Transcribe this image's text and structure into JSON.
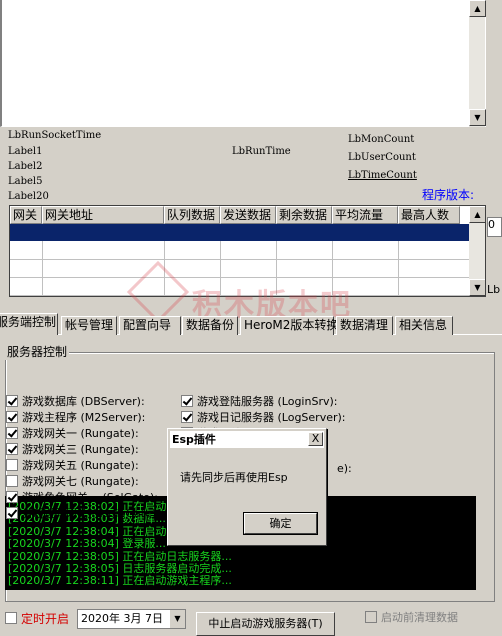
{
  "labels": {
    "lb_run_socket_time": "LbRunSocketTime",
    "label1": "Label1",
    "label2": "Label2",
    "label5": "Label5",
    "label20": "Label20",
    "lb_run_time": "LbRunTime",
    "lb_mon_count": "LbMonCount",
    "lb_user_count": "LbUserCount",
    "lb_time_count": "LbTimeCount",
    "program_version": "程序版本:"
  },
  "grid": {
    "columns": [
      "网关",
      "网关地址",
      "队列数据",
      "发送数据",
      "剩余数据",
      "平均流量",
      "最高人数"
    ]
  },
  "side": {
    "input_text": "0",
    "lb_text": "Lb"
  },
  "tabs": [
    "服务端控制",
    "帐号管理",
    "配置向导",
    "数据备份",
    "HeroM2版本转换",
    "数据清理",
    "相关信息"
  ],
  "server_control": {
    "title": "服务器控制",
    "left": [
      {
        "label": "游戏数据库 (DBServer):",
        "checked": true
      },
      {
        "label": "游戏主程序 (M2Server):",
        "checked": true
      },
      {
        "label": "游戏网关一 (Rungate):",
        "checked": true
      },
      {
        "label": "游戏网关三 (Rungate):",
        "checked": true
      },
      {
        "label": "游戏网关五 (Rungate):",
        "checked": false
      },
      {
        "label": "游戏网关七 (Rungate):",
        "checked": false
      },
      {
        "label": "游戏角色网关一 (SelGate):",
        "checked": true
      },
      {
        "label": "游戏登陆网关 (LoginGate):",
        "checked": true
      }
    ],
    "right": [
      {
        "label": "游戏登陆服务器 (LoginSrv):",
        "checked": true
      },
      {
        "label": "游戏日记服务器 (LogServer):",
        "checked": true
      },
      {
        "label": "游戏网关二 (Rungate):",
        "checked": true
      },
      {
        "label": "游戏网关四 (Rungate):",
        "checked": false
      }
    ],
    "partial_text": "e):"
  },
  "log": [
    "[2020/3/7 12:38:02] 正在启动...",
    "[2020/3/7 12:38:03] 数据库...",
    "[2020/3/7 12:38:04] 正在启动...",
    "[2020/3/7 12:38:04] 登录服...",
    "[2020/3/7 12:38:05] 正在启动日志服务器...",
    "[2020/3/7 12:38:05] 日志服务器启动完成...",
    "[2020/3/7 12:38:11] 正在启动游戏主程序..."
  ],
  "dialog": {
    "title": "Esp插件",
    "close": "X",
    "message": "请先同步后再使用Esp",
    "ok": "确定"
  },
  "bottom": {
    "timer_label": "定时开启",
    "date": "2020年  3月  7日",
    "start_button": "中止启动游戏服务器(T)",
    "clear_label": "启动前清理数据"
  },
  "watermark": "积木版本吧",
  "colors": {
    "selection": "#0a246a",
    "log_text": "#17d51e",
    "version_text": "#0000ff",
    "timer_label": "#d40000"
  }
}
